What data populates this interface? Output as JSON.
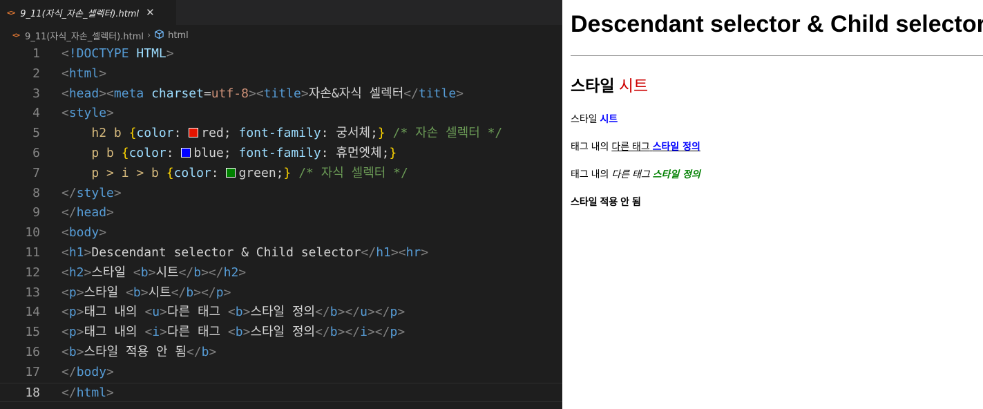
{
  "editor": {
    "tab": {
      "icon": "html-file-icon",
      "title": "9_11(자식_자손_셀렉터).html",
      "close_glyph": "✕"
    },
    "breadcrumb": {
      "file": "9_11(자식_자손_셀렉터).html",
      "symbol": "html",
      "separator": "›"
    },
    "lines": [
      {
        "n": "1"
      },
      {
        "n": "2"
      },
      {
        "n": "3"
      },
      {
        "n": "4"
      },
      {
        "n": "5"
      },
      {
        "n": "6"
      },
      {
        "n": "7"
      },
      {
        "n": "8"
      },
      {
        "n": "9"
      },
      {
        "n": "10"
      },
      {
        "n": "11"
      },
      {
        "n": "12"
      },
      {
        "n": "13"
      },
      {
        "n": "14"
      },
      {
        "n": "15"
      },
      {
        "n": "16"
      },
      {
        "n": "17"
      },
      {
        "n": "18"
      }
    ],
    "code": {
      "l1_doctype": "!DOCTYPE",
      "l1_html": "HTML",
      "html": "html",
      "head": "head",
      "meta": "meta",
      "charset_attr": "charset",
      "charset_val": "utf-8",
      "title": "title",
      "title_text": "자손&자식 셀렉터",
      "style": "style",
      "body": "body",
      "h1": "h1",
      "hr": "hr",
      "h2": "h2",
      "p": "p",
      "b": "b",
      "u": "u",
      "i": "i",
      "css_color": "color",
      "css_font_family": "font-family",
      "sel1": "h2 b",
      "sel2": "p b",
      "sel3": "p > i > b",
      "val_red": "red",
      "val_blue": "blue",
      "val_green": "green",
      "font1": "궁서체",
      "font2": "휴먼엣체",
      "comment1": "/* 자손 셀렉터 */",
      "comment2": "/* 자식 셀렉터 */",
      "h1_text": "Descendant selector & Child selector",
      "style_word": "스타일",
      "sheet_word": "시트",
      "p3_prefix": "태그 내의",
      "p3_mid": "다른 태그",
      "p3_bold": "스타일 정의",
      "b_text": "스타일 적용 안 됨"
    },
    "swatches": {
      "red": "#e51400",
      "blue": "#0000ff",
      "green": "#008000"
    }
  },
  "preview": {
    "h1": "Descendant selector & Child selector",
    "h2_plain": "스타일",
    "h2_bold": "시트",
    "p1_plain": "스타일",
    "p1_bold": "시트",
    "p2_plain": "태그 내의",
    "p2_u": "다른 태그",
    "p2_bold": "스타일 정의",
    "p3_plain": "태그 내의",
    "p3_i": "다른 태그",
    "p3_bold": "스타일 정의",
    "b_text": "스타일 적용 안 됨",
    "colors": {
      "h2_b": "#cc0000",
      "p_b": "#0000ff",
      "i_b": "#008000"
    }
  }
}
